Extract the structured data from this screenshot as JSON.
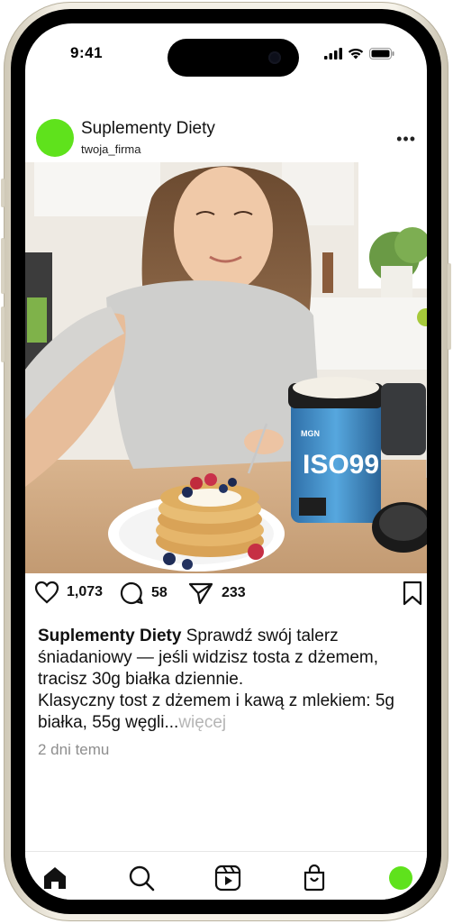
{
  "status_bar": {
    "time": "9:41"
  },
  "post": {
    "account_name": "Suplementy Diety",
    "handle": "twoja_firma",
    "more_icon": "more-horizontal-icon",
    "avatar_color": "#5fe21c",
    "image": {
      "scene": "woman-selfie-with-pancakes-and-protein-tub",
      "product_label": "ISO99",
      "product_brand": "MGN"
    },
    "stats": {
      "likes": "1,073",
      "comments": "58",
      "shares": "233"
    },
    "caption": {
      "author": "Suplementy Diety",
      "text": "Sprawdź swój talerz śniadaniowy — jeśli widzisz tosta z dżemem, tracisz 30g białka dziennie.",
      "line2": "Klasyczny tost z dżemem i kawą z mlekiem: 5g białka, 55g węgli...",
      "more_label": "więcej"
    },
    "timestamp": "2 dni temu"
  },
  "tab_bar": {
    "items": [
      "home-icon",
      "search-icon",
      "reels-icon",
      "shop-icon",
      "profile-avatar"
    ],
    "avatar_color": "#5fe21c"
  }
}
